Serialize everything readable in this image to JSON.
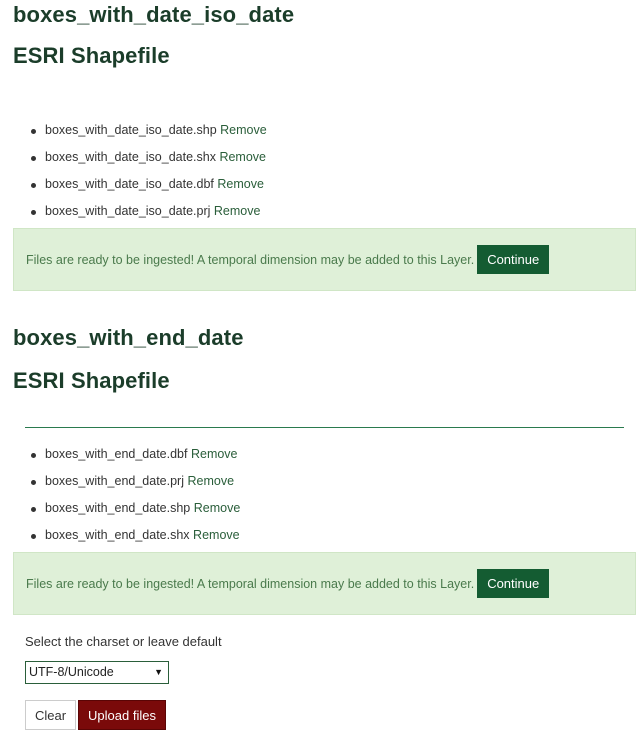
{
  "layers": [
    {
      "name": "boxes_with_date_iso_date",
      "type": "ESRI Shapefile",
      "files": [
        {
          "file": "boxes_with_date_iso_date.shp",
          "remove": "Remove"
        },
        {
          "file": "boxes_with_date_iso_date.shx",
          "remove": "Remove"
        },
        {
          "file": "boxes_with_date_iso_date.dbf",
          "remove": "Remove"
        },
        {
          "file": "boxes_with_date_iso_date.prj",
          "remove": "Remove"
        }
      ],
      "message": "Files are ready to be ingested! A temporal dimension may be added to this Layer.",
      "continue_label": "Continue"
    },
    {
      "name": "boxes_with_end_date",
      "type": "ESRI Shapefile",
      "files": [
        {
          "file": "boxes_with_end_date.dbf",
          "remove": "Remove"
        },
        {
          "file": "boxes_with_end_date.prj",
          "remove": "Remove"
        },
        {
          "file": "boxes_with_end_date.shp",
          "remove": "Remove"
        },
        {
          "file": "boxes_with_end_date.shx",
          "remove": "Remove"
        }
      ],
      "message": "Files are ready to be ingested! A temporal dimension may be added to this Layer.",
      "continue_label": "Continue"
    }
  ],
  "charset": {
    "label": "Select the charset or leave default",
    "selected": "UTF-8/Unicode",
    "arrow_icon": "triangle-down-icon"
  },
  "actions": {
    "clear_label": "Clear",
    "upload_label": "Upload files"
  },
  "colors": {
    "heading": "#1b3d2a",
    "link": "#2a5e3a",
    "alert_bg": "#dff0d8",
    "continue_bg": "#145c32",
    "upload_bg": "#7a0a0a"
  }
}
